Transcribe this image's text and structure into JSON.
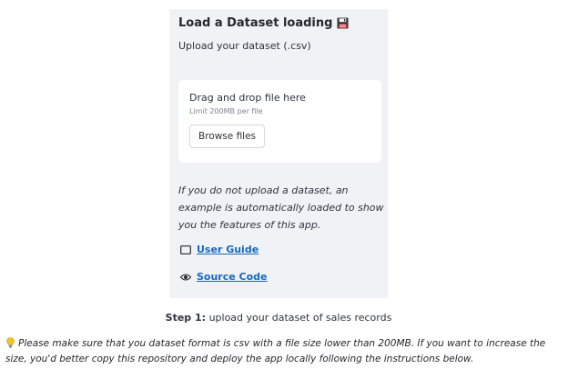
{
  "sidebar": {
    "title": "Load a Dataset loading",
    "title_icon": "floppy-disk-icon",
    "upload_label": "Upload your dataset (.csv)",
    "uploader": {
      "drop_text": "Drag and drop file here",
      "limit_text": "Limit 200MB per file",
      "browse_label": "Browse files"
    },
    "info_text": "If you do not upload a dataset, an example is automatically loaded to show you the features of this app.",
    "links": [
      {
        "icon": "book-icon",
        "label": "User Guide"
      },
      {
        "icon": "eye-icon",
        "label": "Source Code"
      }
    ]
  },
  "caption": {
    "step_label": "Step 1:",
    "text": "upload your dataset of sales records"
  },
  "note": {
    "icon": "lightbulb-icon",
    "text": "Please make sure that you dataset format is csv with a file size lower than 200MB. If you want to increase the size, you'd better copy this repository and deploy the app locally following the instructions below."
  },
  "colors": {
    "sidebar_bg": "#f0f2f6",
    "link": "#1769bd",
    "text": "#31333f"
  }
}
